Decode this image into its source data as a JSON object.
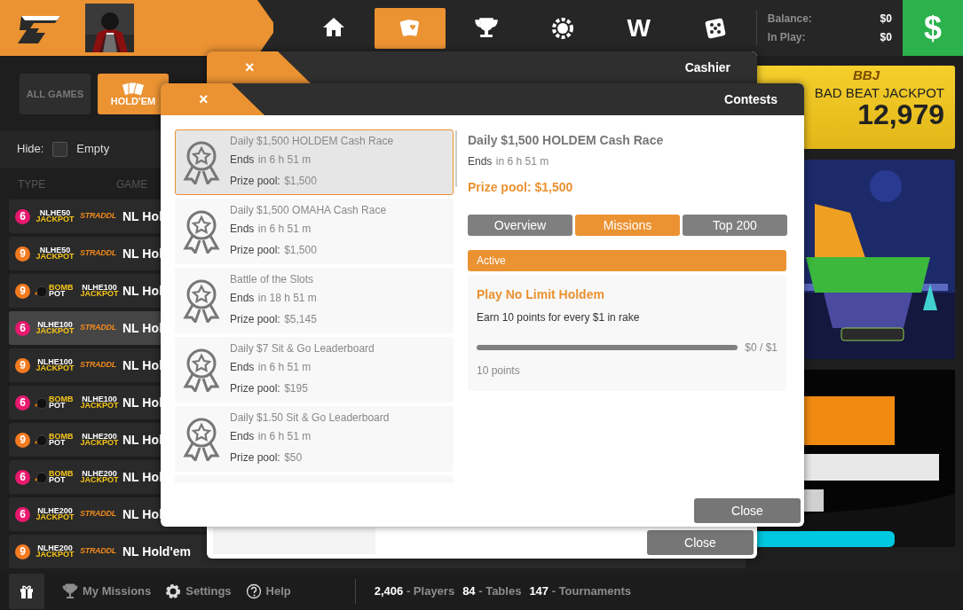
{
  "top_bar": {
    "nav": [
      {
        "selected": false
      },
      {
        "selected": true
      },
      {
        "selected": false
      },
      {
        "selected": false
      },
      {
        "selected": false,
        "label": "W"
      },
      {
        "selected": false
      }
    ],
    "balance": {
      "label": "Balance:",
      "value": "$0"
    },
    "in_play": {
      "label": "In Play:",
      "value": "$0"
    },
    "cashier_button": "$"
  },
  "lobby": {
    "tabs": [
      {
        "label": "ALL GAMES",
        "selected": false
      },
      {
        "label": "HOLD'EM",
        "selected": true
      }
    ],
    "hide": {
      "label": "Hide:",
      "option": "Empty",
      "checked": false
    },
    "columns": [
      "TYPE",
      "GAME"
    ],
    "rows": [
      {
        "seats": "6",
        "color": "#e8196f",
        "tags": [
          {
            "kind": "jackpot",
            "top": "NLHE50",
            "bottom": "JACKPOT"
          },
          {
            "kind": "straddle",
            "text": "STRADDL"
          }
        ],
        "game": "NL Hol",
        "selected": false
      },
      {
        "seats": "9",
        "color": "#f47a20",
        "tags": [
          {
            "kind": "jackpot",
            "top": "NLHE50",
            "bottom": "JACKPOT"
          },
          {
            "kind": "straddle",
            "text": "STRADDL"
          }
        ],
        "game": "NL Hol",
        "selected": false
      },
      {
        "seats": "9",
        "color": "#f47a20",
        "tags": [
          {
            "kind": "bomb",
            "top": "BOMB",
            "bottom": "POT"
          },
          {
            "kind": "jackpot",
            "top": "NLHE100",
            "bottom": "JACKPOT"
          }
        ],
        "game": "NL Hol",
        "selected": false
      },
      {
        "seats": "6",
        "color": "#e8196f",
        "tags": [
          {
            "kind": "jackpot",
            "top": "NLHE100",
            "bottom": "JACKPOT"
          },
          {
            "kind": "straddle",
            "text": "STRADDL"
          }
        ],
        "game": "NL Hol",
        "selected": true
      },
      {
        "seats": "9",
        "color": "#f47a20",
        "tags": [
          {
            "kind": "jackpot",
            "top": "NLHE100",
            "bottom": "JACKPOT"
          },
          {
            "kind": "straddle",
            "text": "STRADDL"
          }
        ],
        "game": "NL Hol",
        "selected": false
      },
      {
        "seats": "6",
        "color": "#e8196f",
        "tags": [
          {
            "kind": "bomb",
            "top": "BOMB",
            "bottom": "POT"
          },
          {
            "kind": "jackpot",
            "top": "NLHE100",
            "bottom": "JACKPOT"
          }
        ],
        "game": "NL Hol",
        "selected": false
      },
      {
        "seats": "9",
        "color": "#f47a20",
        "tags": [
          {
            "kind": "bomb",
            "top": "BOMB",
            "bottom": "POT"
          },
          {
            "kind": "jackpot",
            "top": "NLHE200",
            "bottom": "JACKPOT"
          }
        ],
        "game": "NL Hol",
        "selected": false
      },
      {
        "seats": "6",
        "color": "#e8196f",
        "tags": [
          {
            "kind": "bomb",
            "top": "BOMB",
            "bottom": "POT"
          },
          {
            "kind": "jackpot",
            "top": "NLHE200",
            "bottom": "JACKPOT"
          }
        ],
        "game": "NL Hol",
        "selected": false
      },
      {
        "seats": "6",
        "color": "#e8196f",
        "tags": [
          {
            "kind": "jackpot",
            "top": "NLHE200",
            "bottom": "JACKPOT"
          },
          {
            "kind": "straddle",
            "text": "STRADDL"
          }
        ],
        "game": "NL Hol",
        "selected": false
      },
      {
        "seats": "9",
        "color": "#f47a20",
        "tags": [
          {
            "kind": "jackpot",
            "top": "NLHE200",
            "bottom": "JACKPOT"
          },
          {
            "kind": "straddle",
            "text": "STRADDL"
          }
        ],
        "game": "NL Hold'em",
        "selected": false
      }
    ]
  },
  "banners": {
    "jackpot": {
      "badge": "BBJ",
      "title": "BAD BEAT JACKPOT",
      "amount": "12,979"
    }
  },
  "cashier": {
    "close_symbol": "×",
    "title": "Cashier",
    "close_button": "Close"
  },
  "contests": {
    "close_symbol": "×",
    "title": "Contests",
    "items": [
      {
        "title": "Daily $1,500 HOLDEM Cash Race",
        "ends_label": "Ends",
        "ends": "in 6 h 51 m",
        "prize_label": "Prize pool:",
        "prize": "$1,500",
        "selected": true
      },
      {
        "title": "Daily $1,500 OMAHA Cash Race",
        "ends_label": "Ends",
        "ends": "in 6 h 51 m",
        "prize_label": "Prize pool:",
        "prize": "$1,500",
        "selected": false
      },
      {
        "title": "Battle of the Slots",
        "ends_label": "Ends",
        "ends": "in 18 h 51 m",
        "prize_label": "Prize pool:",
        "prize": "$5,145",
        "selected": false
      },
      {
        "title": "Daily $7 Sit & Go Leaderboard",
        "ends_label": "Ends",
        "ends": "in 6 h 51 m",
        "prize_label": "Prize pool:",
        "prize": "$195",
        "selected": false
      },
      {
        "title": "Daily $1.50 Sit & Go Leaderboard",
        "ends_label": "Ends",
        "ends": "in 6 h 51 m",
        "prize_label": "Prize pool:",
        "prize": "$50",
        "selected": false
      }
    ],
    "detail": {
      "title": "Daily $1,500 HOLDEM Cash Race",
      "ends_label": "Ends",
      "ends": "in 6 h 51 m",
      "prize": "Prize pool: $1,500",
      "tabs": [
        {
          "label": "Overview",
          "selected": false
        },
        {
          "label": "Missions",
          "selected": true
        },
        {
          "label": "Top 200",
          "selected": false
        }
      ],
      "section": "Active",
      "missions": [
        {
          "title": "Play No Limit Holdem",
          "description": "Earn 10 points for every $1 in rake",
          "level": 0,
          "progress": "$0 / $1",
          "points": "10 points"
        }
      ]
    },
    "close_button": "Close"
  },
  "bottom_bar": {
    "links": [
      "My Missions",
      "Settings",
      "Help"
    ],
    "stats": [
      "**2,406** - Players",
      "**84** - Tables",
      "**147** - Tournaments"
    ]
  }
}
